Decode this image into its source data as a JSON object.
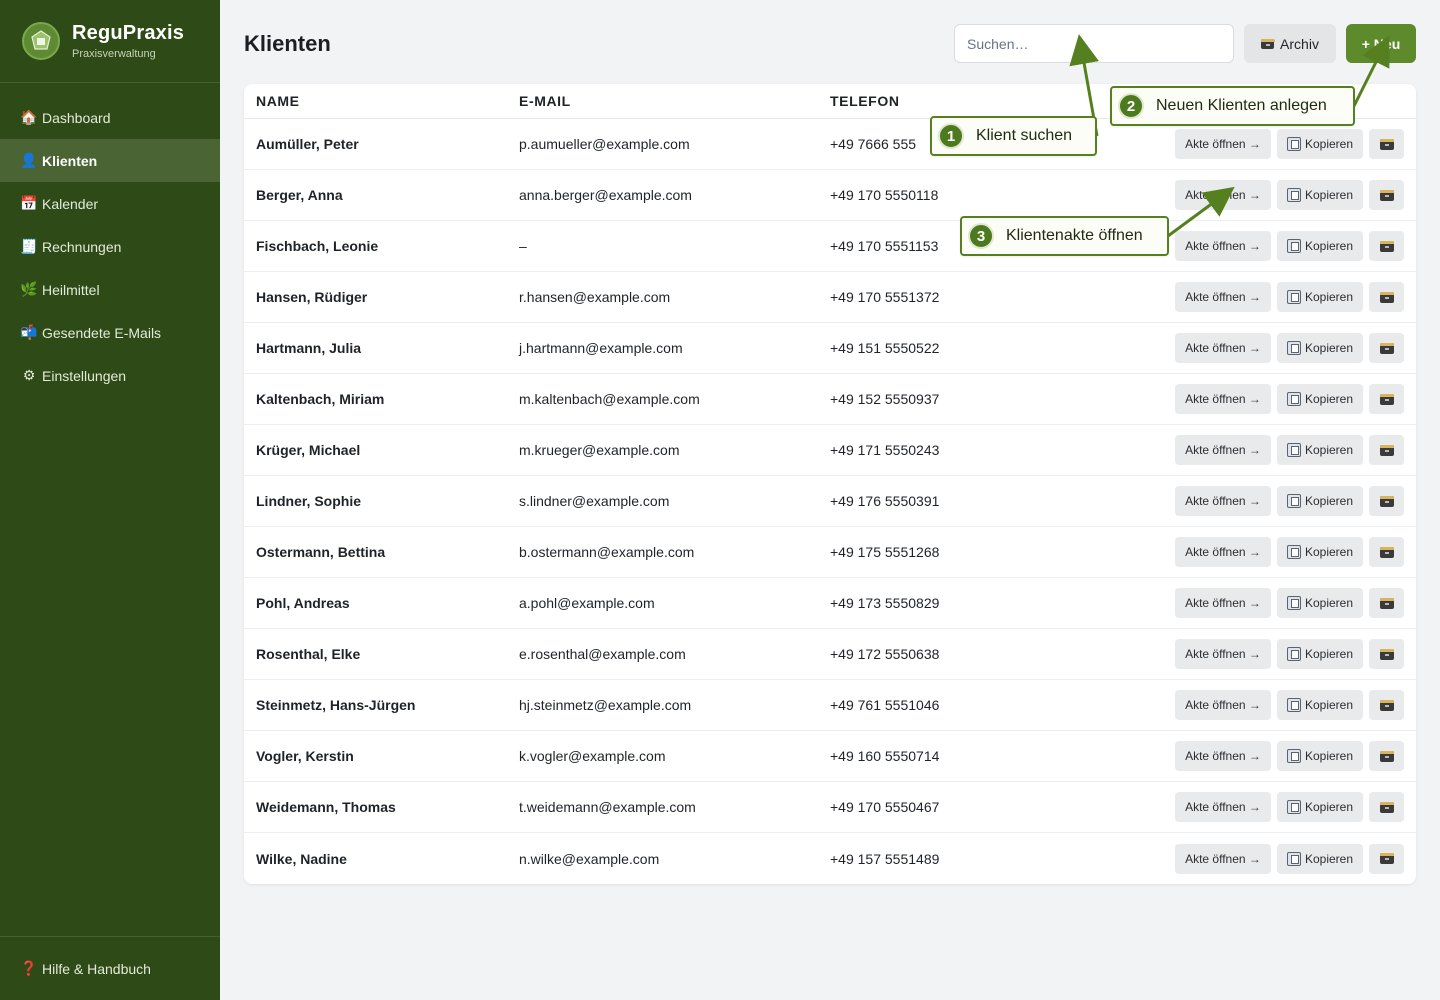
{
  "app": {
    "name": "ReguPraxis",
    "subtitle": "Praxisverwaltung"
  },
  "sidebar": {
    "items": [
      {
        "label": "Dashboard",
        "icon": "house-icon",
        "glyph": "🏠"
      },
      {
        "label": "Klienten",
        "icon": "person-icon",
        "glyph": "👤",
        "active": true
      },
      {
        "label": "Kalender",
        "icon": "calendar-icon",
        "glyph": "📅"
      },
      {
        "label": "Rechnungen",
        "icon": "calculator-icon",
        "glyph": "🧾"
      },
      {
        "label": "Heilmittel",
        "icon": "herb-icon",
        "glyph": "🌿"
      },
      {
        "label": "Gesendete E-Mails",
        "icon": "mailbox-icon",
        "glyph": "📬"
      },
      {
        "label": "Einstellungen",
        "icon": "gear-icon",
        "glyph": "⚙"
      }
    ],
    "footer": {
      "label": "Hilfe & Handbuch",
      "icon": "question-icon",
      "glyph": "❓"
    }
  },
  "header": {
    "title": "Klienten",
    "search_placeholder": "Suchen…",
    "archive_label": "Archiv",
    "new_label": "+ Neu"
  },
  "table": {
    "columns": [
      "NAME",
      "E-MAIL",
      "TELEFON"
    ],
    "action_labels": {
      "open": "Akte öffnen →",
      "copy": "Kopieren"
    },
    "rows": [
      {
        "name": "Aumüller, Peter",
        "email": "p.aumueller@example.com",
        "phone": "+49 7666 555"
      },
      {
        "name": "Berger, Anna",
        "email": "anna.berger@example.com",
        "phone": "+49 170 5550118"
      },
      {
        "name": "Fischbach, Leonie",
        "email": "–",
        "phone": "+49 170 5551153"
      },
      {
        "name": "Hansen, Rüdiger",
        "email": "r.hansen@example.com",
        "phone": "+49 170 5551372"
      },
      {
        "name": "Hartmann, Julia",
        "email": "j.hartmann@example.com",
        "phone": "+49 151 5550522"
      },
      {
        "name": "Kaltenbach, Miriam",
        "email": "m.kaltenbach@example.com",
        "phone": "+49 152 5550937"
      },
      {
        "name": "Krüger, Michael",
        "email": "m.krueger@example.com",
        "phone": "+49 171 5550243"
      },
      {
        "name": "Lindner, Sophie",
        "email": "s.lindner@example.com",
        "phone": "+49 176 5550391"
      },
      {
        "name": "Ostermann, Bettina",
        "email": "b.ostermann@example.com",
        "phone": "+49 175 5551268"
      },
      {
        "name": "Pohl, Andreas",
        "email": "a.pohl@example.com",
        "phone": "+49 173 5550829"
      },
      {
        "name": "Rosenthal, Elke",
        "email": "e.rosenthal@example.com",
        "phone": "+49 172 5550638"
      },
      {
        "name": "Steinmetz, Hans-Jürgen",
        "email": "hj.steinmetz@example.com",
        "phone": "+49 761 5551046"
      },
      {
        "name": "Vogler, Kerstin",
        "email": "k.vogler@example.com",
        "phone": "+49 160 5550714"
      },
      {
        "name": "Weidemann, Thomas",
        "email": "t.weidemann@example.com",
        "phone": "+49 170 5550467"
      },
      {
        "name": "Wilke, Nadine",
        "email": "n.wilke@example.com",
        "phone": "+49 157 5551489"
      }
    ]
  },
  "callouts": [
    {
      "number": "1",
      "label": "Klient suchen"
    },
    {
      "number": "2",
      "label": "Neuen Klienten anlegen"
    },
    {
      "number": "3",
      "label": "Klientenakte öffnen"
    }
  ],
  "colors": {
    "sidebar": "#2d4a17",
    "sidebar_active": "#4a6434",
    "accent": "#5d8a2b",
    "callout_border": "#56801f"
  }
}
